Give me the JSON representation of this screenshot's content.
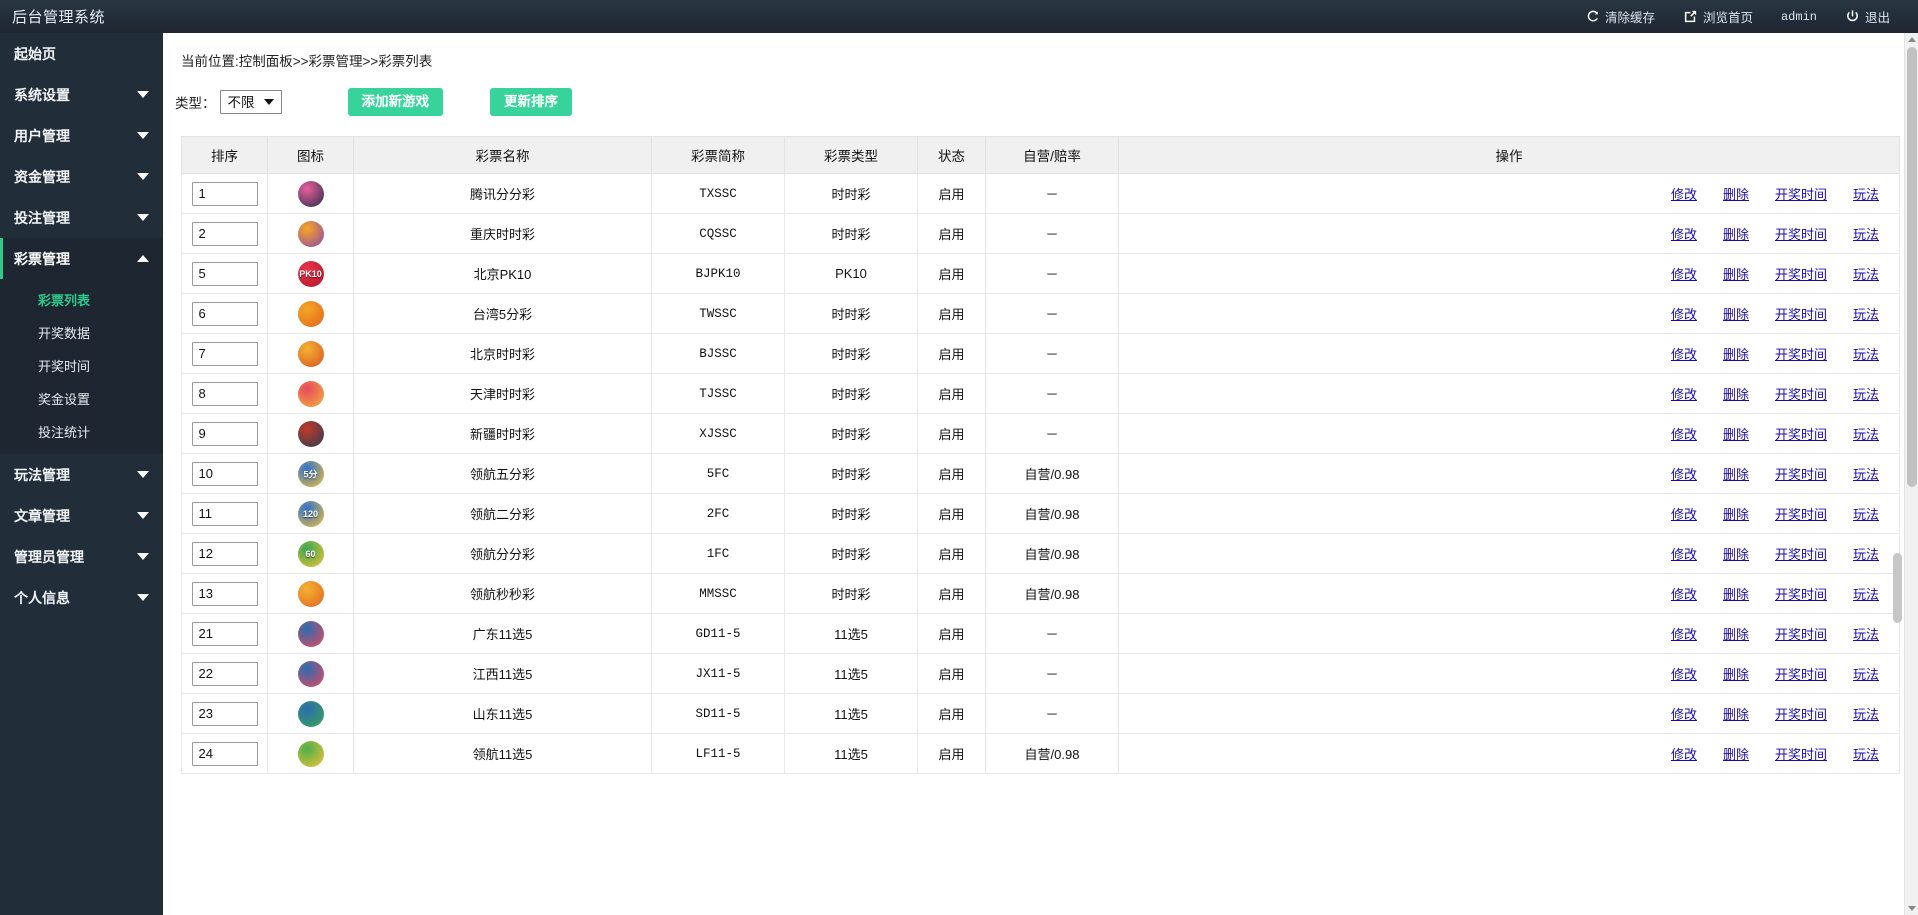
{
  "topbar": {
    "brand": "后台管理系统",
    "clear_cache": "清除缓存",
    "view_home": "浏览首页",
    "user": "admin",
    "logout": "退出"
  },
  "sidebar": {
    "items": [
      {
        "label": "起始页",
        "caret": "",
        "active": false
      },
      {
        "label": "系统设置",
        "caret": "down",
        "active": false
      },
      {
        "label": "用户管理",
        "caret": "down",
        "active": false
      },
      {
        "label": "资金管理",
        "caret": "down",
        "active": false
      },
      {
        "label": "投注管理",
        "caret": "down",
        "active": false
      },
      {
        "label": "彩票管理",
        "caret": "up",
        "active": true
      },
      {
        "label": "玩法管理",
        "caret": "down",
        "active": false
      },
      {
        "label": "文章管理",
        "caret": "down",
        "active": false
      },
      {
        "label": "管理员管理",
        "caret": "down",
        "active": false
      },
      {
        "label": "个人信息",
        "caret": "down",
        "active": false
      }
    ],
    "submenu": [
      {
        "label": "彩票列表",
        "active": true
      },
      {
        "label": "开奖数据",
        "active": false
      },
      {
        "label": "开奖时间",
        "active": false
      },
      {
        "label": "奖金设置",
        "active": false
      },
      {
        "label": "投注统计",
        "active": false
      }
    ]
  },
  "breadcrumb": "当前位置:控制面板>>彩票管理>>彩票列表",
  "toolbar": {
    "type_label": "类型：",
    "type_value": "不限",
    "type_options": [
      "不限"
    ],
    "add_game_label": "添加新游戏",
    "update_order_label": "更新排序"
  },
  "table": {
    "headers": [
      "排序",
      "图标",
      "彩票名称",
      "彩票简称",
      "彩票类型",
      "状态",
      "自营/赔率",
      "操作"
    ],
    "action_labels": [
      "修改",
      "删除",
      "开奖时间",
      "玩法"
    ],
    "rows": [
      {
        "order": "1",
        "icon_text": "",
        "icon_c1": "#e75f9c",
        "icon_c2": "#2b2b4a",
        "name": "腾讯分分彩",
        "short": "TXSSC",
        "type": "时时彩",
        "status": "启用",
        "rate": "－"
      },
      {
        "order": "2",
        "icon_text": "",
        "icon_c1": "#f6a623",
        "icon_c2": "#8e44ad",
        "name": "重庆时时彩",
        "short": "CQSSC",
        "type": "时时彩",
        "status": "启用",
        "rate": "－"
      },
      {
        "order": "5",
        "icon_text": "PK10",
        "icon_c1": "#e8344a",
        "icon_c2": "#b3152a",
        "name": "北京PK10",
        "short": "BJPK10",
        "type": "PK10",
        "status": "启用",
        "rate": "－"
      },
      {
        "order": "6",
        "icon_text": "",
        "icon_c1": "#f5a623",
        "icon_c2": "#e2651e",
        "name": "台湾5分彩",
        "short": "TWSSC",
        "type": "时时彩",
        "status": "启用",
        "rate": "－"
      },
      {
        "order": "7",
        "icon_text": "",
        "icon_c1": "#f3b233",
        "icon_c2": "#d9541f",
        "name": "北京时时彩",
        "short": "BJSSC",
        "type": "时时彩",
        "status": "启用",
        "rate": "－"
      },
      {
        "order": "8",
        "icon_text": "",
        "icon_c1": "#e8495e",
        "icon_c2": "#f2b33d",
        "name": "天津时时彩",
        "short": "TJSSC",
        "type": "时时彩",
        "status": "启用",
        "rate": "－"
      },
      {
        "order": "9",
        "icon_text": "",
        "icon_c1": "#c0392b",
        "icon_c2": "#2c3e50",
        "name": "新疆时时彩",
        "short": "XJSSC",
        "type": "时时彩",
        "status": "启用",
        "rate": "－"
      },
      {
        "order": "10",
        "icon_text": "5分",
        "icon_c1": "#2f6fd0",
        "icon_c2": "#f2c335",
        "name": "领航五分彩",
        "short": "5FC",
        "type": "时时彩",
        "status": "启用",
        "rate": "自营/0.98"
      },
      {
        "order": "11",
        "icon_text": "120",
        "icon_c1": "#2f6fd0",
        "icon_c2": "#f2c335",
        "name": "领航二分彩",
        "short": "2FC",
        "type": "时时彩",
        "status": "启用",
        "rate": "自营/0.98"
      },
      {
        "order": "12",
        "icon_text": "60",
        "icon_c1": "#3aa655",
        "icon_c2": "#f2c335",
        "name": "领航分分彩",
        "short": "1FC",
        "type": "时时彩",
        "status": "启用",
        "rate": "自营/0.98"
      },
      {
        "order": "13",
        "icon_text": "",
        "icon_c1": "#f3b233",
        "icon_c2": "#e2651e",
        "name": "领航秒秒彩",
        "short": "MMSSC",
        "type": "时时彩",
        "status": "启用",
        "rate": "自营/0.98"
      },
      {
        "order": "21",
        "icon_text": "",
        "icon_c1": "#2b6cb0",
        "icon_c2": "#e8495e",
        "name": "广东11选5",
        "short": "GD11-5",
        "type": "11选5",
        "status": "启用",
        "rate": "－"
      },
      {
        "order": "22",
        "icon_text": "",
        "icon_c1": "#2b6cb0",
        "icon_c2": "#e8495e",
        "name": "江西11选5",
        "short": "JX11-5",
        "type": "11选5",
        "status": "启用",
        "rate": "－"
      },
      {
        "order": "23",
        "icon_text": "",
        "icon_c1": "#2b6cb0",
        "icon_c2": "#3aa655",
        "name": "山东11选5",
        "short": "SD11-5",
        "type": "11选5",
        "status": "启用",
        "rate": "－"
      },
      {
        "order": "24",
        "icon_text": "",
        "icon_c1": "#4cae4c",
        "icon_c2": "#f2c335",
        "name": "领航11选5",
        "short": "LF11-5",
        "type": "11选5",
        "status": "启用",
        "rate": "自营/0.98"
      }
    ]
  },
  "colors": {
    "accent": "#38d39b",
    "sidebar_bg": "#222d3a",
    "submenu_bg": "#1d2631",
    "link": "#1a0dab"
  }
}
